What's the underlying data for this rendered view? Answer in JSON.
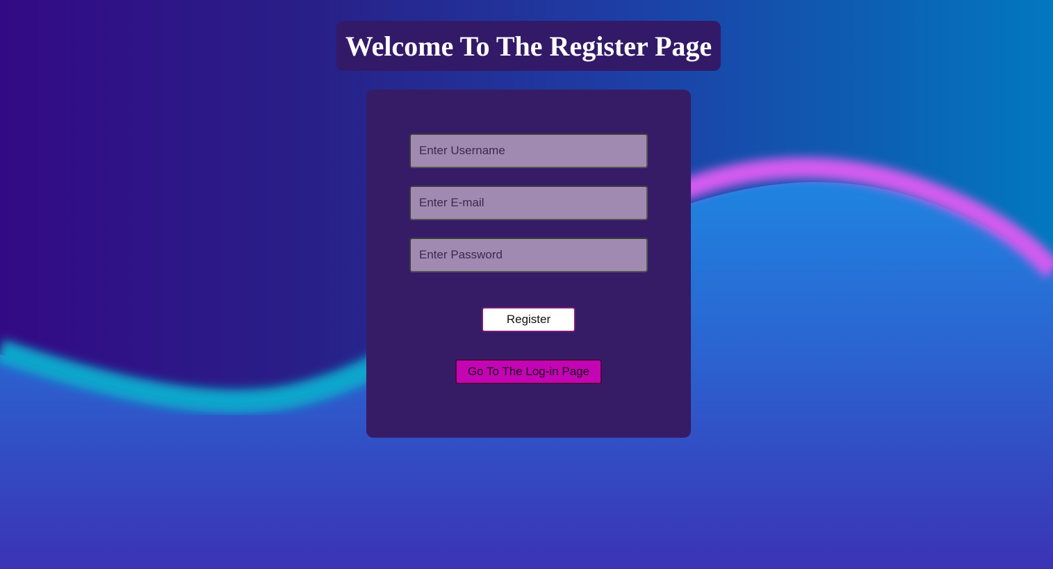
{
  "page": {
    "title": "Welcome To The Register Page"
  },
  "form": {
    "username_placeholder": "Enter Username",
    "email_placeholder": "Enter E-mail",
    "password_placeholder": "Enter Password",
    "register_label": "Register",
    "login_link_label": "Go To The Log-in Page"
  },
  "colors": {
    "panel": "#361c66",
    "input_bg": "#a18ab2",
    "login_button": "#c405b4",
    "wave_cyan": "#0aa6cc",
    "wave_pink": "#d35cf0"
  }
}
